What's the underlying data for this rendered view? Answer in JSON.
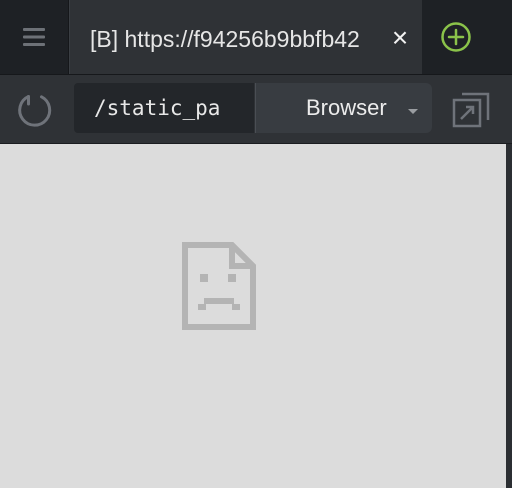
{
  "tab": {
    "title": "[B] https://f94256b9bbfb42",
    "close_glyph": "×"
  },
  "toolbar": {
    "url": "/static_pa",
    "browser_label": "Browser"
  },
  "icons": {
    "menu": "menu-icon",
    "new_tab": "plus-circle-icon",
    "reload": "reload-icon",
    "popout": "popout-icon",
    "error_page": "sad-page-icon",
    "dropdown": "caret-down-icon"
  },
  "colors": {
    "new_tab_accent": "#8bc34a",
    "tabbar_bg": "#1e2125",
    "toolbar_bg": "#2f3236",
    "viewport_bg": "#dcdcdc",
    "error_icon": "#b4b4b4"
  }
}
